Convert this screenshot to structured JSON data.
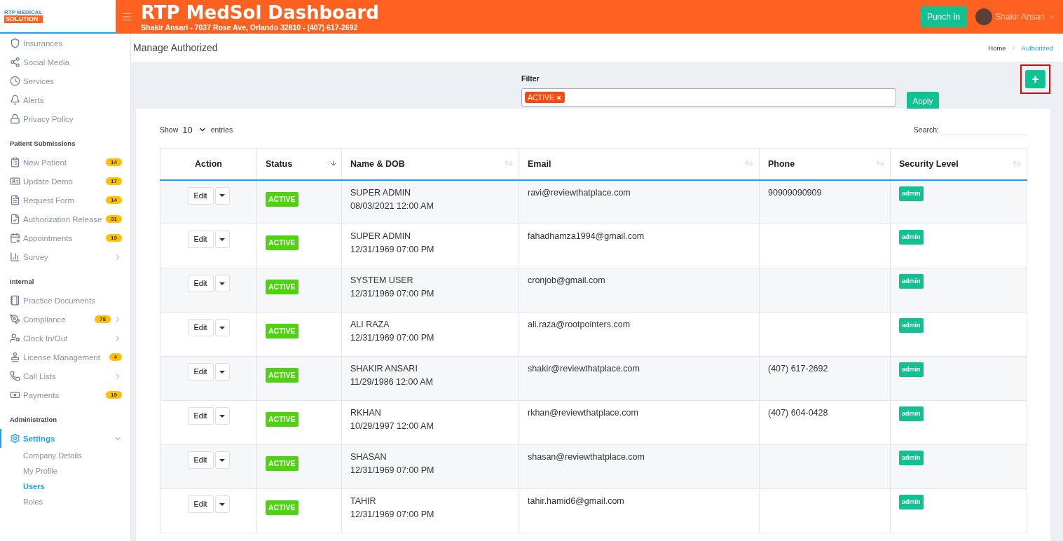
{
  "brand": {
    "logo_top": "RTP MEDICAL",
    "logo_bottom": "SOLUTION"
  },
  "header": {
    "title": "RTP MedSol Dashboard",
    "subtitle": "Shakir Ansari - 7037 Rose Ave, Orlando 32810 - (407) 617-2692",
    "punch_button": "Punch In",
    "user_name": "Shakir Ansari"
  },
  "sidebar": {
    "sections": [
      {
        "items": [
          {
            "label": "Insurances"
          },
          {
            "label": "Social Media"
          },
          {
            "label": "Services"
          },
          {
            "label": "Alerts"
          },
          {
            "label": "Privacy Policy"
          }
        ]
      },
      {
        "title": "Patient Submissions",
        "items": [
          {
            "label": "New Patient",
            "badge": "14"
          },
          {
            "label": "Update Demo",
            "badge": "17"
          },
          {
            "label": "Request Form",
            "badge": "14"
          },
          {
            "label": "Authorization Release",
            "badge": "31"
          },
          {
            "label": "Appointments",
            "badge": "19"
          },
          {
            "label": "Survey",
            "expanded": false
          }
        ]
      },
      {
        "title": "Internal",
        "items": [
          {
            "label": "Practice Documents"
          },
          {
            "label": "Compliance",
            "badge": "78",
            "expanded": false
          },
          {
            "label": "Clock In/Out",
            "expanded": false
          },
          {
            "label": "License Management",
            "badge": "4"
          },
          {
            "label": "Call Lists",
            "expanded": false
          },
          {
            "label": "Payments",
            "badge": "19"
          }
        ]
      },
      {
        "title": "Administration",
        "items": [
          {
            "label": "Settings",
            "expanded": true,
            "selected": true,
            "children": [
              {
                "label": "Company Details",
                "selected": false
              },
              {
                "label": "My Profile",
                "selected": false
              },
              {
                "label": "Users",
                "selected": true
              },
              {
                "label": "Roles",
                "selected": false
              }
            ]
          }
        ]
      }
    ]
  },
  "page": {
    "title": "Manage Authorized",
    "breadcrumb": [
      {
        "label": "Home",
        "selected": false
      },
      {
        "label": "Authorized",
        "selected": true
      }
    ]
  },
  "filter": {
    "label": "Filter",
    "tags": [
      "ACTIVE"
    ],
    "apply_button": "Apply",
    "add_button": "+"
  },
  "table": {
    "show_label": "Show",
    "page_size": "10",
    "entries_label": "entries",
    "search_label": "Search:",
    "columns": [
      {
        "label": "Action"
      },
      {
        "label": "Status",
        "sorted": true
      },
      {
        "label": "Name & DOB",
        "sorted": false
      },
      {
        "label": "Email",
        "sorted": false
      },
      {
        "label": "Phone",
        "sorted": false
      },
      {
        "label": "Security Level",
        "sorted": false
      }
    ],
    "rows": [
      {
        "action": "Edit",
        "status": "ACTIVE",
        "name": "SUPER ADMIN",
        "dob": "08/03/2021 12:00 AM",
        "email": "ravi@reviewthatplace.com",
        "phone": "90909090909",
        "level": "admin"
      },
      {
        "action": "Edit",
        "status": "ACTIVE",
        "name": "SUPER ADMIN",
        "dob": "12/31/1969 07:00 PM",
        "email": "fahadhamza1994@gmail.com",
        "level": "admin"
      },
      {
        "action": "Edit",
        "status": "ACTIVE",
        "name": "SYSTEM USER",
        "dob": "12/31/1969 07:00 PM",
        "email": "cronjob@gmail.com",
        "level": "admin"
      },
      {
        "action": "Edit",
        "status": "ACTIVE",
        "name": "ALI RAZA",
        "dob": "12/31/1969 07:00 PM",
        "email": "ali.raza@rootpointers.com",
        "level": "admin"
      },
      {
        "action": "Edit",
        "status": "ACTIVE",
        "name": "SHAKIR ANSARI",
        "dob": "11/29/1986 12:00 AM",
        "email": "shakir@reviewthatplace.com",
        "phone": "(407) 617-2692",
        "level": "admin"
      },
      {
        "action": "Edit",
        "status": "ACTIVE",
        "name": "RKHAN",
        "dob": "10/29/1997 12:00 AM",
        "email": "rkhan@reviewthatplace.com",
        "phone": "(407) 604-0428",
        "level": "admin"
      },
      {
        "action": "Edit",
        "status": "ACTIVE",
        "name": "SHASAN",
        "dob": "12/31/1969 07:00 PM",
        "email": "shasan@reviewthatplace.com",
        "level": "admin"
      },
      {
        "action": "Edit",
        "status": "ACTIVE",
        "name": "TAHIR",
        "dob": "12/31/1969 07:00 PM",
        "email": "tahir.hamid6@gmail.com",
        "level": "admin"
      }
    ]
  }
}
